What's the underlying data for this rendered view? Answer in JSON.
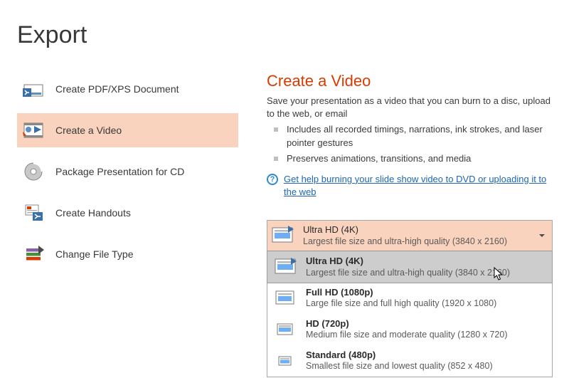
{
  "page_title": "Export",
  "sidebar": {
    "items": [
      {
        "label": "Create PDF/XPS Document",
        "selected": false
      },
      {
        "label": "Create a Video",
        "selected": true
      },
      {
        "label": "Package Presentation for CD",
        "selected": false
      },
      {
        "label": "Create Handouts",
        "selected": false
      },
      {
        "label": "Change File Type",
        "selected": false
      }
    ]
  },
  "content": {
    "title": "Create a Video",
    "description": "Save your presentation as a video that you can burn to a disc, upload to the web, or email",
    "bullets": [
      "Includes all recorded timings, narrations, ink strokes, and laser pointer gestures",
      "Preserves animations, transitions, and media"
    ],
    "help_link": "Get help burning your slide show video to DVD or uploading it to the web"
  },
  "quality": {
    "selected": {
      "title": "Ultra HD (4K)",
      "subtitle": "Largest file size and ultra-high quality (3840 x 2160)"
    },
    "options": [
      {
        "title": "Ultra HD (4K)",
        "subtitle": "Largest file size and ultra-high quality (3840 x 2160)",
        "hovered": true
      },
      {
        "title": "Full HD (1080p)",
        "subtitle": "Large file size and full high quality (1920 x 1080)",
        "hovered": false
      },
      {
        "title": "HD (720p)",
        "subtitle": "Medium file size and moderate quality (1280 x 720)",
        "hovered": false
      },
      {
        "title": "Standard (480p)",
        "subtitle": "Smallest file size and lowest quality (852 x 480)",
        "hovered": false
      }
    ]
  },
  "colors": {
    "accent": "#d83b01",
    "selection_bg": "#fad3be",
    "link": "#1e66b1"
  }
}
